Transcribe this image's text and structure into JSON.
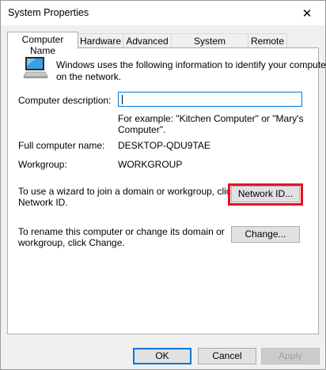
{
  "window": {
    "title": "System Properties",
    "close_glyph": "✕"
  },
  "tabs": [
    {
      "label": "Computer Name",
      "active": true
    },
    {
      "label": "Hardware",
      "active": false
    },
    {
      "label": "Advanced",
      "active": false
    },
    {
      "label": "System Protection",
      "active": false
    },
    {
      "label": "Remote",
      "active": false
    }
  ],
  "panel": {
    "intro_line1": "Windows uses the following information to identify your computer",
    "intro_line2": "on the network.",
    "computer_description_label": "Computer description:",
    "computer_description_value": "",
    "example_line1": "For example: \"Kitchen Computer\" or \"Mary's",
    "example_line2": "Computer\".",
    "full_name_label": "Full computer name:",
    "full_name_value": "DESKTOP-QDU9TAE",
    "workgroup_label": "Workgroup:",
    "workgroup_value": "WORKGROUP",
    "wizard_line1": "To use a wizard to join a domain or workgroup, click",
    "wizard_line2": "Network ID.",
    "network_id_button": "Network ID...",
    "rename_line1": "To rename this computer or change its domain or",
    "rename_line2": "workgroup, click Change.",
    "change_button": "Change..."
  },
  "footer": {
    "ok": "OK",
    "cancel": "Cancel",
    "apply": "Apply"
  },
  "colors": {
    "highlight": "#e81123",
    "focus_border": "#0078d7",
    "monitor_screen": "#3aa0e8"
  }
}
